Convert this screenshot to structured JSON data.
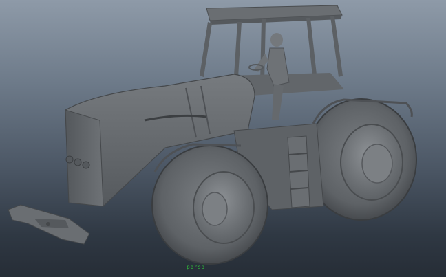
{
  "viewport": {
    "background_top": "#8e9aa8",
    "background_bottom": "#262d36",
    "model_color": "#6b6f73",
    "pivot_label": "persp",
    "pivot_color": "#2fbf3a"
  },
  "objects": [
    "tractor-cab",
    "tractor-hood",
    "front-wheel",
    "rear-wheel",
    "driver-figure",
    "detached-hitch"
  ]
}
